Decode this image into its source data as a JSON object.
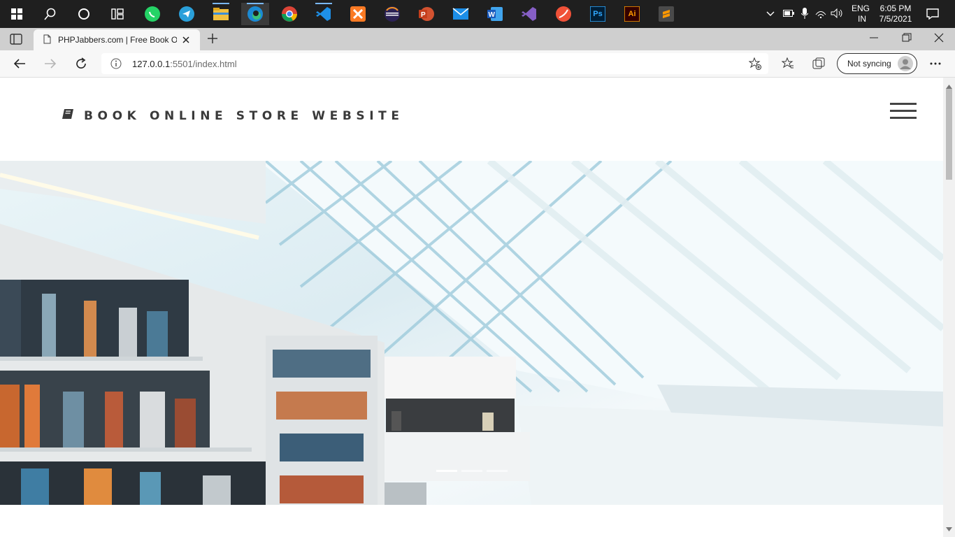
{
  "taskbar": {
    "apps": [
      {
        "name": "start-button"
      },
      {
        "name": "search-button"
      },
      {
        "name": "cortana-button"
      },
      {
        "name": "task-view-button"
      },
      {
        "name": "whatsapp-icon"
      },
      {
        "name": "telegram-icon"
      },
      {
        "name": "file-explorer-icon"
      },
      {
        "name": "edge-icon"
      },
      {
        "name": "chrome-icon"
      },
      {
        "name": "vscode-icon"
      },
      {
        "name": "xampp-icon"
      },
      {
        "name": "eclipse-icon"
      },
      {
        "name": "powerpoint-icon"
      },
      {
        "name": "mail-icon"
      },
      {
        "name": "word-icon"
      },
      {
        "name": "visual-studio-icon"
      },
      {
        "name": "swift-icon"
      },
      {
        "name": "photoshop-icon"
      },
      {
        "name": "illustrator-icon"
      },
      {
        "name": "sublime-icon"
      }
    ],
    "lang_top": "ENG",
    "lang_bottom": "IN",
    "time": "6:05 PM",
    "date": "7/5/2021",
    "ps_label": "Ps",
    "ai_label": "Ai"
  },
  "browser": {
    "tab_title": "PHPJabbers.com | Free Book Online Store Website",
    "url_host": "127.0.0.1",
    "url_rest": ":5501/index.html",
    "sync_label": "Not syncing"
  },
  "site": {
    "brand": "BOOK ONLINE STORE WEBSITE",
    "slides": 3,
    "active_slide": 1
  }
}
